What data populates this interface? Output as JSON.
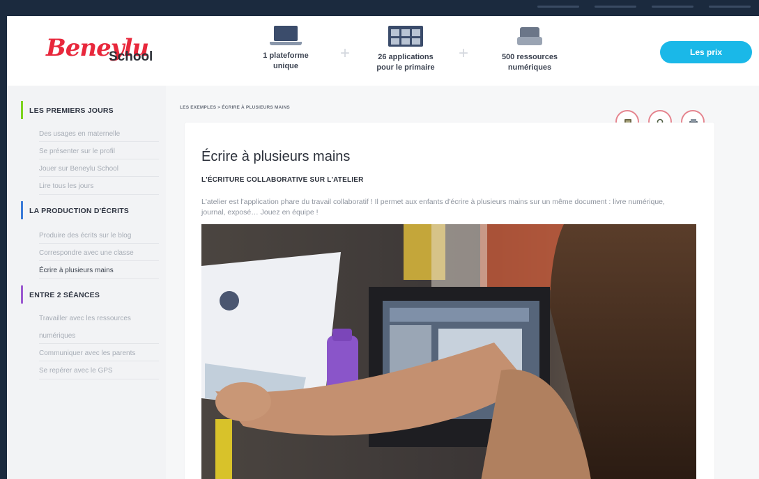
{
  "brand": {
    "script": "Beneylu",
    "school": "School"
  },
  "features": [
    {
      "line1": "1 plateforme",
      "line2": "unique",
      "icon": "laptop-icon"
    },
    {
      "line1": "26 applications",
      "line2": "pour le primaire",
      "icon": "apps-grid-icon"
    },
    {
      "line1": "500 ressources",
      "line2": "numériques",
      "icon": "resources-box-icon"
    }
  ],
  "plus_sign": "+",
  "prix_button": "Les prix",
  "sidebar": {
    "sections": [
      {
        "title": "LES PREMIERS JOURS",
        "color": "#7ed321",
        "items": [
          "Des usages en maternelle",
          "Se présenter sur le profil",
          "Jouer sur Beneylu School",
          "Lire tous les jours"
        ]
      },
      {
        "title": "LA PRODUCTION D'ÉCRITS",
        "color": "#3b7bd8",
        "items": [
          "Produire des écrits sur le blog",
          "Correspondre avec une classe",
          "Écrire à plusieurs mains"
        ]
      },
      {
        "title": "ENTRE 2 SÉANCES",
        "color": "#9b59d0",
        "items": [
          "Travailler avec les ressources",
          "numériques",
          "Communiquer avec les parents",
          "Se repérer avec le GPS"
        ]
      }
    ],
    "active_item": "Écrire à plusieurs mains"
  },
  "breadcrumb": "LES EXEMPLES > ÉCRIRE À PLUSIEURS MAINS",
  "article": {
    "title": "Écrire à plusieurs mains",
    "subtitle": "L'ÉCRITURE COLLABORATIVE SUR L'ATELIER",
    "body": "L'atelier est l'application phare du travail collaboratif ! Il permet aux enfants d'écrire à plusieurs mains sur un même document : livre numérique, journal, exposé… Jouez en équipe !"
  },
  "action_icons": [
    "book-icon",
    "search-icon",
    "printer-icon"
  ],
  "colors": {
    "navy": "#1b2a3e",
    "brand_red": "#e8283c",
    "cyan": "#1ab8e8",
    "sidebar_bg": "#f2f3f5"
  }
}
